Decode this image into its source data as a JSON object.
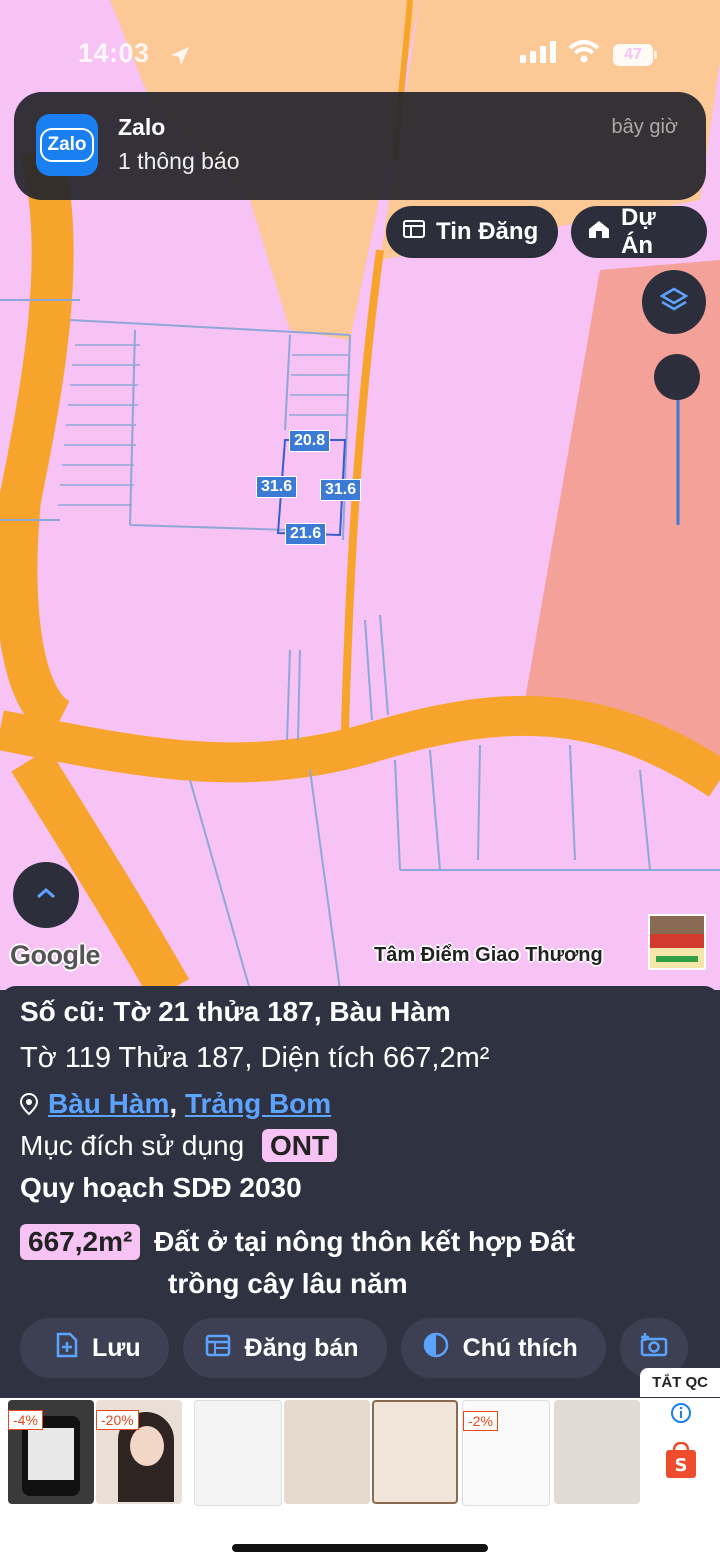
{
  "status": {
    "time": "14:03",
    "battery": "47"
  },
  "notification": {
    "app": "Zalo",
    "icon_label": "Zalo",
    "message": "1 thông báo",
    "time": "bây giờ"
  },
  "map": {
    "tabs": [
      {
        "icon": "list-icon",
        "label": "Tin Đăng"
      },
      {
        "icon": "home-icon",
        "label": "Dự Án"
      }
    ],
    "dimensions": {
      "top": "20.8",
      "left": "31.6",
      "right": "31.6",
      "bottom": "21.6"
    },
    "google_logo": "Google",
    "brand": "Tâm Điểm Giao Thương"
  },
  "parcel": {
    "old_id": "Số cũ: Tờ 21 thửa 187, Bàu Hàm",
    "info": "Tờ 119 Thửa 187, Diện tích 667,2m²",
    "location": {
      "commune": "Bàu Hàm",
      "district": "Trảng Bom"
    },
    "usage_label": "Mục đích sử dụng",
    "usage_code": "ONT",
    "plan_title": "Quy hoạch SDĐ 2030",
    "plan_area": "667,2m²",
    "plan_desc_1": "Đất ở tại nông thôn kết hợp Đất",
    "plan_desc_2": "trồng cây lâu năm"
  },
  "actions": [
    {
      "icon": "file-plus-icon",
      "label": "Lưu"
    },
    {
      "icon": "calendar-icon",
      "label": "Đăng bán"
    },
    {
      "icon": "contrast-icon",
      "label": "Chú thích"
    }
  ],
  "ads": {
    "close_label": "TẮT QC",
    "items": [
      {
        "badge": "-4%"
      },
      {
        "badge": "-20%"
      },
      {
        "badge": ""
      },
      {
        "badge": ""
      },
      {
        "badge": ""
      },
      {
        "badge": "-2%"
      },
      {
        "badge": ""
      }
    ]
  },
  "colors": {
    "map_pink": "#f6c3f4",
    "road_orange": "#f7a42c",
    "panel_bg": "#2f3241",
    "link_blue": "#5ba3ff"
  }
}
